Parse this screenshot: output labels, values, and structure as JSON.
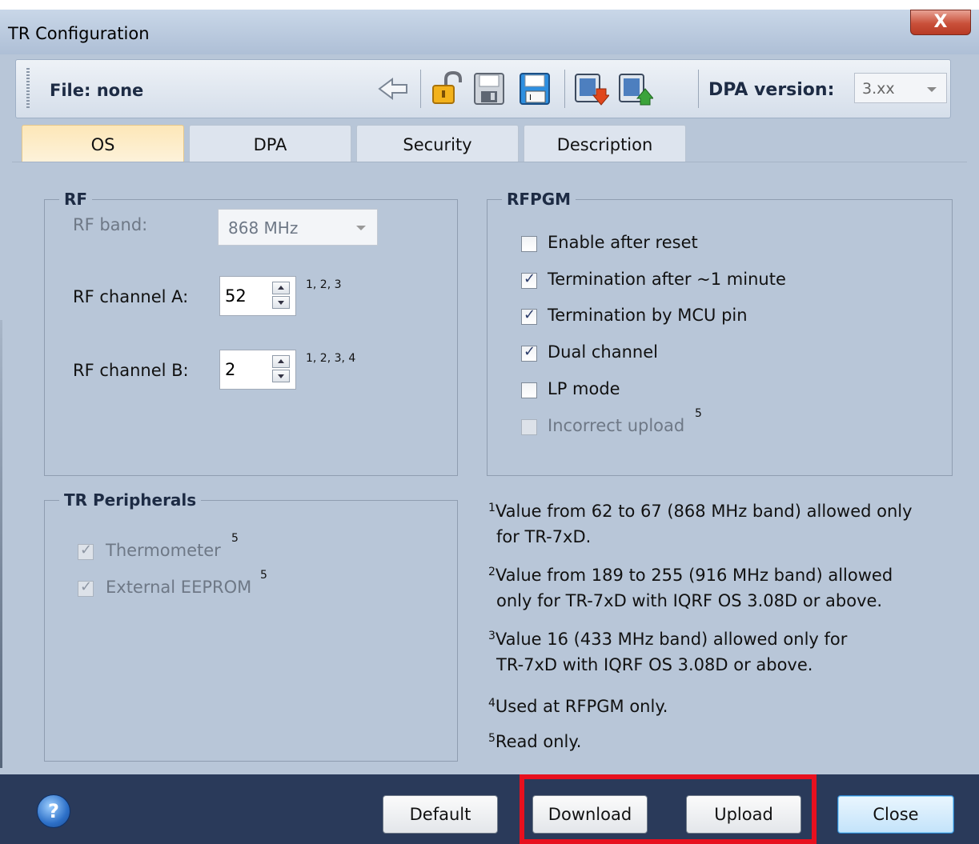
{
  "window": {
    "title": "TR Configuration",
    "close_glyph": "X"
  },
  "toolbar": {
    "file_label": "File: none",
    "dpa_label": "DPA version:",
    "dpa_value": "3.xx",
    "icons": [
      "back-arrow-icon",
      "unlock-icon",
      "save-icon",
      "save-as-icon",
      "download-to-module-icon",
      "upload-from-module-icon"
    ]
  },
  "tabs": [
    {
      "label": "OS",
      "active": true
    },
    {
      "label": "DPA",
      "active": false
    },
    {
      "label": "Security",
      "active": false
    },
    {
      "label": "Description",
      "active": false
    }
  ],
  "rf": {
    "legend": "RF",
    "band_label": "RF band:",
    "band_value": "868 MHz",
    "channel_a_label": "RF channel A:",
    "channel_a_value": "52",
    "channel_a_notes": "1, 2, 3",
    "channel_b_label": "RF channel B:",
    "channel_b_value": "2",
    "channel_b_notes": "1, 2, 3, 4"
  },
  "rfpgm": {
    "legend": "RFPGM",
    "options": [
      {
        "label": "Enable after reset",
        "checked": false,
        "enabled": true,
        "note": ""
      },
      {
        "label": "Termination after ~1 minute",
        "checked": true,
        "enabled": true,
        "note": ""
      },
      {
        "label": "Termination by MCU pin",
        "checked": true,
        "enabled": true,
        "note": ""
      },
      {
        "label": "Dual channel",
        "checked": true,
        "enabled": true,
        "note": ""
      },
      {
        "label": "LP mode",
        "checked": false,
        "enabled": true,
        "note": ""
      },
      {
        "label": "Incorrect upload",
        "checked": false,
        "enabled": false,
        "note": "5"
      }
    ]
  },
  "peripherals": {
    "legend": "TR Peripherals",
    "options": [
      {
        "label": "Thermometer",
        "checked": true,
        "enabled": false,
        "note": "5"
      },
      {
        "label": "External EEPROM",
        "checked": true,
        "enabled": false,
        "note": "5"
      }
    ]
  },
  "notes": [
    {
      "num": "1",
      "lines": [
        "Value from 62 to 67 (868 MHz band) allowed only",
        "for TR-7xD."
      ]
    },
    {
      "num": "2",
      "lines": [
        "Value from 189 to 255 (916 MHz band) allowed",
        "only for TR-7xD with IQRF OS 3.08D or above."
      ]
    },
    {
      "num": "3",
      "lines": [
        "Value 16 (433 MHz band) allowed only for",
        "TR-7xD with IQRF OS 3.08D or above."
      ]
    },
    {
      "num": "4",
      "lines": [
        "Used at RFPGM only."
      ]
    },
    {
      "num": "5",
      "lines": [
        "Read only."
      ]
    }
  ],
  "buttons": {
    "help": "?",
    "default": "Default",
    "download": "Download",
    "upload": "Upload",
    "close": "Close"
  },
  "colors": {
    "highlight": "#e8101e",
    "bottom_bar": "#2a3a5a",
    "panel": "#b8c6d8"
  }
}
